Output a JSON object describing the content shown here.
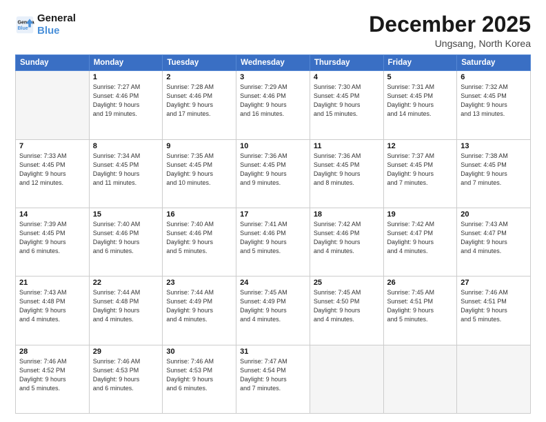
{
  "logo": {
    "line1": "General",
    "line2": "Blue"
  },
  "title": "December 2025",
  "subtitle": "Ungsang, North Korea",
  "weekdays": [
    "Sunday",
    "Monday",
    "Tuesday",
    "Wednesday",
    "Thursday",
    "Friday",
    "Saturday"
  ],
  "weeks": [
    [
      {
        "day": "",
        "info": ""
      },
      {
        "day": "1",
        "info": "Sunrise: 7:27 AM\nSunset: 4:46 PM\nDaylight: 9 hours\nand 19 minutes."
      },
      {
        "day": "2",
        "info": "Sunrise: 7:28 AM\nSunset: 4:46 PM\nDaylight: 9 hours\nand 17 minutes."
      },
      {
        "day": "3",
        "info": "Sunrise: 7:29 AM\nSunset: 4:46 PM\nDaylight: 9 hours\nand 16 minutes."
      },
      {
        "day": "4",
        "info": "Sunrise: 7:30 AM\nSunset: 4:45 PM\nDaylight: 9 hours\nand 15 minutes."
      },
      {
        "day": "5",
        "info": "Sunrise: 7:31 AM\nSunset: 4:45 PM\nDaylight: 9 hours\nand 14 minutes."
      },
      {
        "day": "6",
        "info": "Sunrise: 7:32 AM\nSunset: 4:45 PM\nDaylight: 9 hours\nand 13 minutes."
      }
    ],
    [
      {
        "day": "7",
        "info": "Sunrise: 7:33 AM\nSunset: 4:45 PM\nDaylight: 9 hours\nand 12 minutes."
      },
      {
        "day": "8",
        "info": "Sunrise: 7:34 AM\nSunset: 4:45 PM\nDaylight: 9 hours\nand 11 minutes."
      },
      {
        "day": "9",
        "info": "Sunrise: 7:35 AM\nSunset: 4:45 PM\nDaylight: 9 hours\nand 10 minutes."
      },
      {
        "day": "10",
        "info": "Sunrise: 7:36 AM\nSunset: 4:45 PM\nDaylight: 9 hours\nand 9 minutes."
      },
      {
        "day": "11",
        "info": "Sunrise: 7:36 AM\nSunset: 4:45 PM\nDaylight: 9 hours\nand 8 minutes."
      },
      {
        "day": "12",
        "info": "Sunrise: 7:37 AM\nSunset: 4:45 PM\nDaylight: 9 hours\nand 7 minutes."
      },
      {
        "day": "13",
        "info": "Sunrise: 7:38 AM\nSunset: 4:45 PM\nDaylight: 9 hours\nand 7 minutes."
      }
    ],
    [
      {
        "day": "14",
        "info": "Sunrise: 7:39 AM\nSunset: 4:45 PM\nDaylight: 9 hours\nand 6 minutes."
      },
      {
        "day": "15",
        "info": "Sunrise: 7:40 AM\nSunset: 4:46 PM\nDaylight: 9 hours\nand 6 minutes."
      },
      {
        "day": "16",
        "info": "Sunrise: 7:40 AM\nSunset: 4:46 PM\nDaylight: 9 hours\nand 5 minutes."
      },
      {
        "day": "17",
        "info": "Sunrise: 7:41 AM\nSunset: 4:46 PM\nDaylight: 9 hours\nand 5 minutes."
      },
      {
        "day": "18",
        "info": "Sunrise: 7:42 AM\nSunset: 4:46 PM\nDaylight: 9 hours\nand 4 minutes."
      },
      {
        "day": "19",
        "info": "Sunrise: 7:42 AM\nSunset: 4:47 PM\nDaylight: 9 hours\nand 4 minutes."
      },
      {
        "day": "20",
        "info": "Sunrise: 7:43 AM\nSunset: 4:47 PM\nDaylight: 9 hours\nand 4 minutes."
      }
    ],
    [
      {
        "day": "21",
        "info": "Sunrise: 7:43 AM\nSunset: 4:48 PM\nDaylight: 9 hours\nand 4 minutes."
      },
      {
        "day": "22",
        "info": "Sunrise: 7:44 AM\nSunset: 4:48 PM\nDaylight: 9 hours\nand 4 minutes."
      },
      {
        "day": "23",
        "info": "Sunrise: 7:44 AM\nSunset: 4:49 PM\nDaylight: 9 hours\nand 4 minutes."
      },
      {
        "day": "24",
        "info": "Sunrise: 7:45 AM\nSunset: 4:49 PM\nDaylight: 9 hours\nand 4 minutes."
      },
      {
        "day": "25",
        "info": "Sunrise: 7:45 AM\nSunset: 4:50 PM\nDaylight: 9 hours\nand 4 minutes."
      },
      {
        "day": "26",
        "info": "Sunrise: 7:45 AM\nSunset: 4:51 PM\nDaylight: 9 hours\nand 5 minutes."
      },
      {
        "day": "27",
        "info": "Sunrise: 7:46 AM\nSunset: 4:51 PM\nDaylight: 9 hours\nand 5 minutes."
      }
    ],
    [
      {
        "day": "28",
        "info": "Sunrise: 7:46 AM\nSunset: 4:52 PM\nDaylight: 9 hours\nand 5 minutes."
      },
      {
        "day": "29",
        "info": "Sunrise: 7:46 AM\nSunset: 4:53 PM\nDaylight: 9 hours\nand 6 minutes."
      },
      {
        "day": "30",
        "info": "Sunrise: 7:46 AM\nSunset: 4:53 PM\nDaylight: 9 hours\nand 6 minutes."
      },
      {
        "day": "31",
        "info": "Sunrise: 7:47 AM\nSunset: 4:54 PM\nDaylight: 9 hours\nand 7 minutes."
      },
      {
        "day": "",
        "info": ""
      },
      {
        "day": "",
        "info": ""
      },
      {
        "day": "",
        "info": ""
      }
    ]
  ]
}
